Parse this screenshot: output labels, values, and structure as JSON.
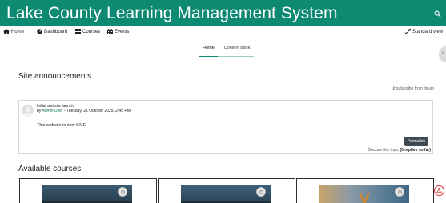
{
  "header": {
    "site_title": "Lake County Learning Management System",
    "search_icon": "search-icon",
    "background_color": "#0e8a73"
  },
  "nav": {
    "items": [
      {
        "label": "Home",
        "icon": "home-icon"
      },
      {
        "label": "Dashboard",
        "icon": "dashboard-icon"
      },
      {
        "label": "Courses",
        "icon": "courses-grid-icon"
      },
      {
        "label": "Events",
        "icon": "calendar-icon"
      }
    ],
    "standard_view": {
      "label": "Standard view",
      "icon": "expand-icon"
    }
  },
  "tabs": [
    {
      "label": "Home",
      "active": true
    },
    {
      "label": "Content bank",
      "active": false
    }
  ],
  "announcements": {
    "heading": "Site announcements",
    "unsubscribe": "Unsubscribe from forum",
    "post": {
      "subject": "Initial website launch",
      "by_prefix": "by",
      "author": "Admin User",
      "date": " - Tuesday, 21 October 2025, 2:45 PM",
      "body": "This website is now LIVE",
      "permalink": "Permalink",
      "discuss_prefix": "Discuss this topic",
      "replies": "(0 replies so far)"
    }
  },
  "courses": {
    "heading": "Available courses",
    "cards": [
      {
        "image": "course-1-image"
      },
      {
        "image": "course-2-image"
      },
      {
        "image": "course-3-image"
      }
    ]
  },
  "accent_color": "#0e8a73",
  "button_color": "#3d4a52"
}
